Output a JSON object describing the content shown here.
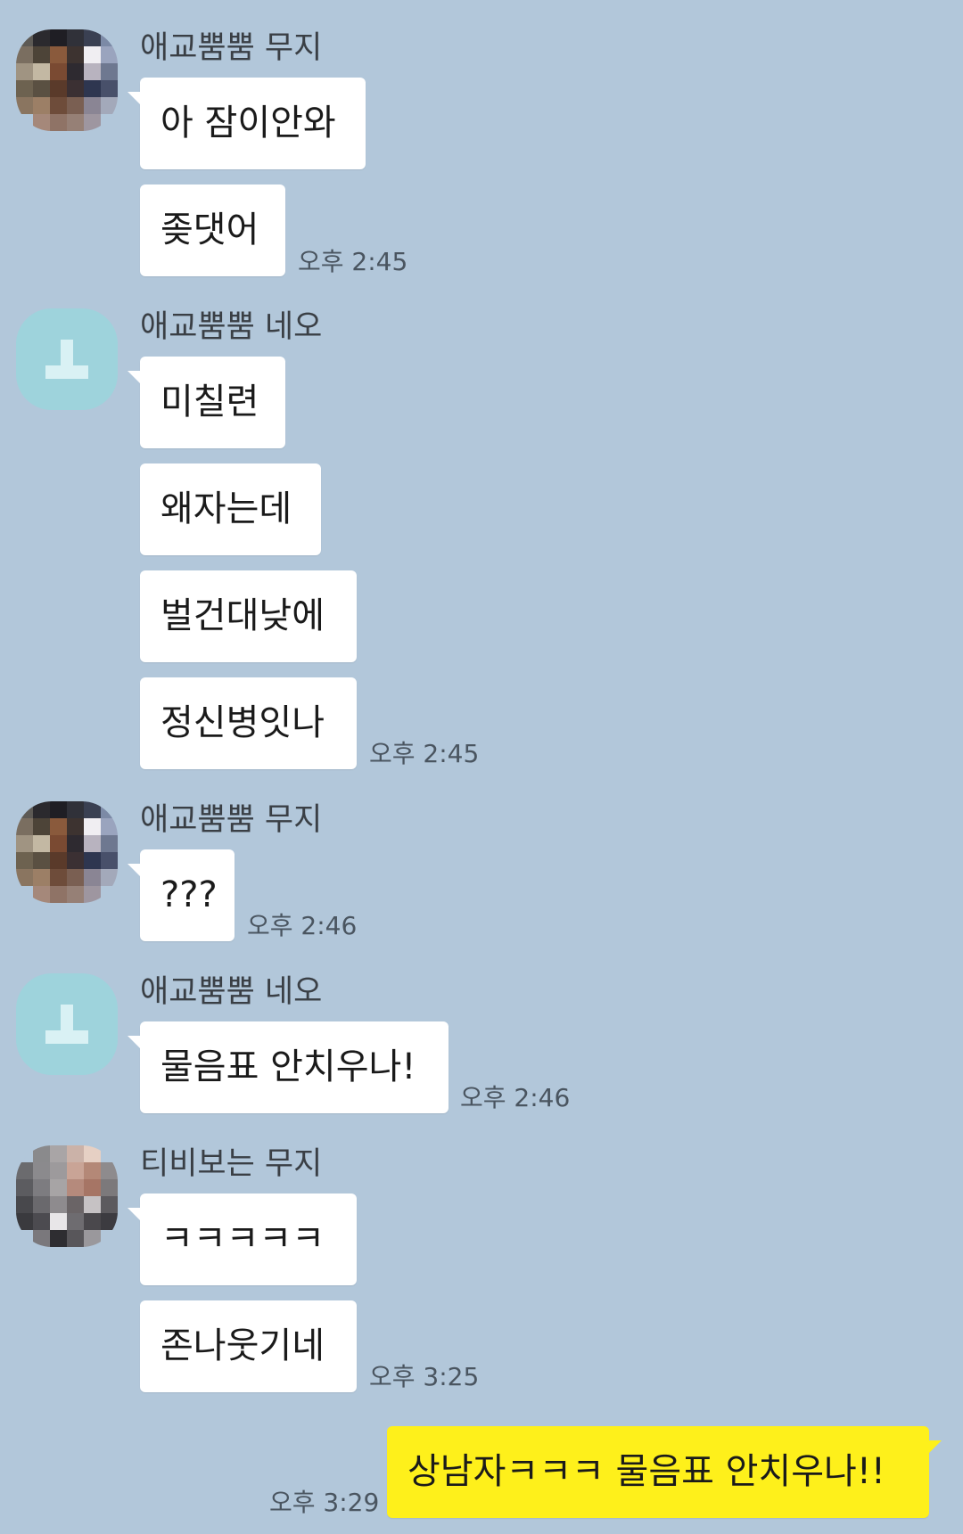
{
  "messages": [
    {
      "sender": "애교뿜뿜 무지",
      "avatar": "pixelated-photo-avatar",
      "bubbles": [
        "아 잠이안와",
        "좆댓어"
      ],
      "time": "오후 2:45"
    },
    {
      "sender": "애교뿜뿜 네오",
      "avatar": "default-profile-avatar",
      "bubbles": [
        "미칠련",
        "왜자는데",
        "벌건대낮에",
        "정신병잇나"
      ],
      "time": "오후 2:45"
    },
    {
      "sender": "애교뿜뿜 무지",
      "avatar": "pixelated-photo-avatar",
      "bubbles": [
        "???"
      ],
      "time": "오후 2:46"
    },
    {
      "sender": "애교뿜뿜 네오",
      "avatar": "default-profile-avatar",
      "bubbles": [
        "물음표 안치우나!"
      ],
      "time": "오후 2:46"
    },
    {
      "sender": "티비보는 무지",
      "avatar": "pixelated-photo-avatar",
      "bubbles": [
        "ㅋㅋㅋㅋㅋ",
        "존나웃기네"
      ],
      "time": "오후 3:25"
    }
  ],
  "my_message": {
    "text": "상남자ㅋㅋㅋ 물음표 안치우나!!",
    "time": "오후 3:29"
  },
  "colors": {
    "background": "#b2c7da",
    "incoming_bubble": "#ffffff",
    "outgoing_bubble": "#fef01b",
    "default_avatar": "#9ed3dc"
  }
}
